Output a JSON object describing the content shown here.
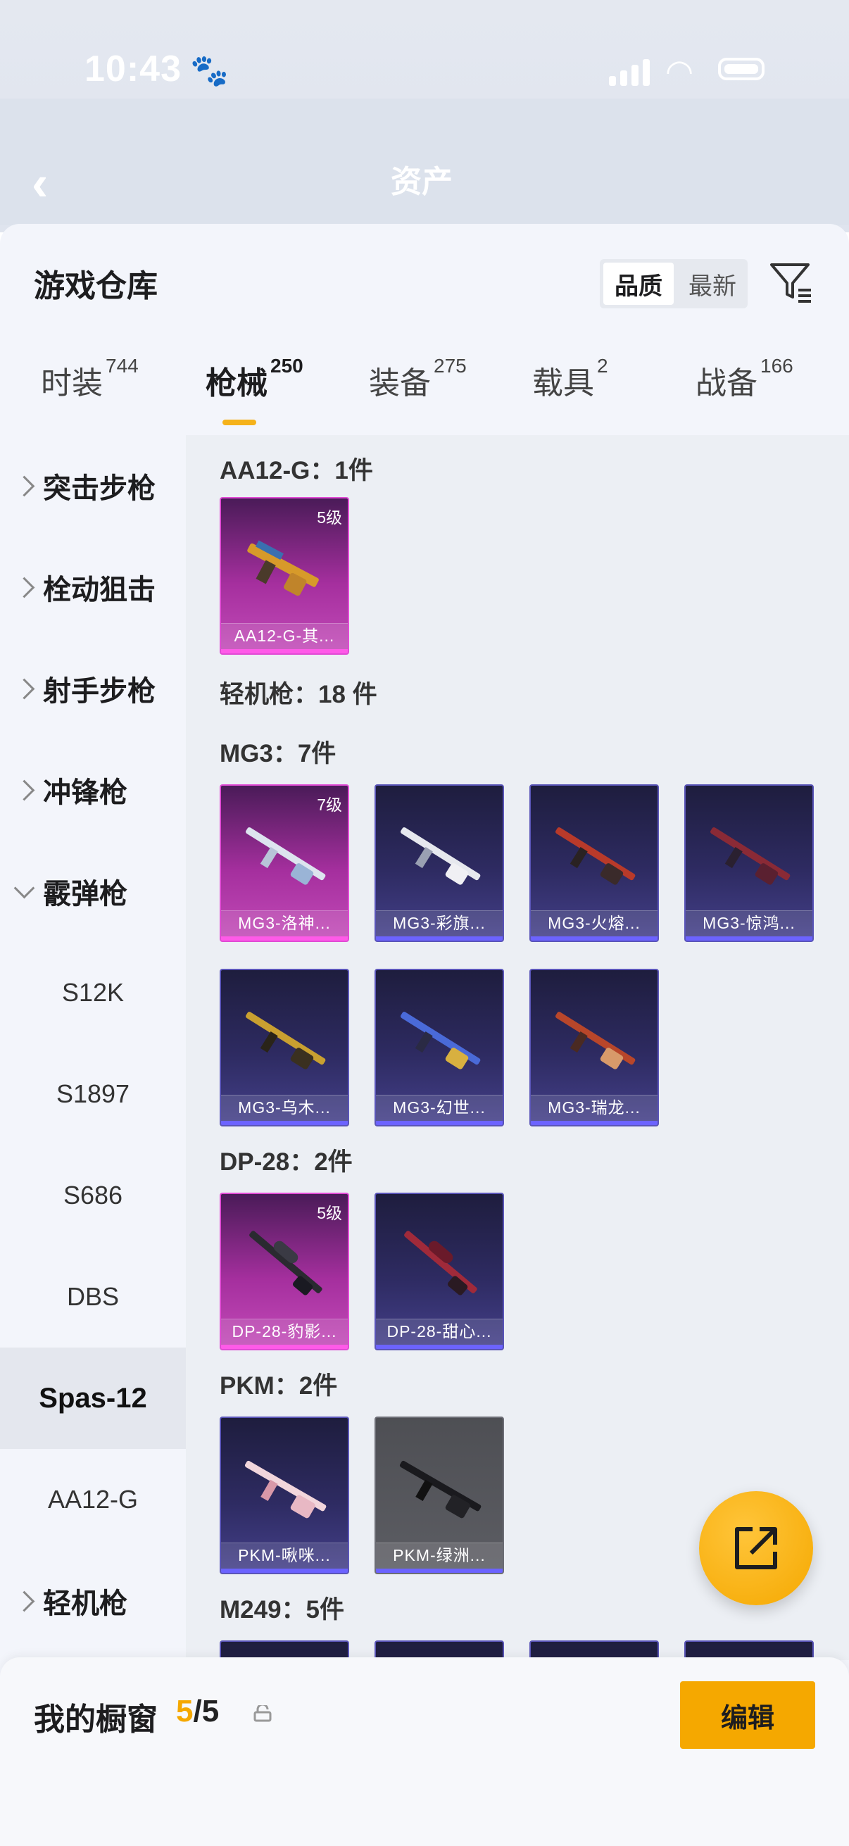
{
  "status_bar": {
    "time": "10:43"
  },
  "header": {
    "title": "资产"
  },
  "warehouse": {
    "title": "游戏仓库",
    "sort_options": [
      "品质",
      "最新"
    ],
    "tabs": [
      {
        "label": "时装",
        "count": "744"
      },
      {
        "label": "枪械",
        "count": "250"
      },
      {
        "label": "装备",
        "count": "275"
      },
      {
        "label": "载具",
        "count": "2"
      },
      {
        "label": "战备",
        "count": "166"
      }
    ]
  },
  "sidebar": {
    "categories": [
      "突击步枪",
      "栓动狙击",
      "射手步枪",
      "冲锋枪",
      "霰弹枪"
    ],
    "shotgun_items": [
      "S12K",
      "S1897",
      "S686",
      "DBS",
      "Spas-12",
      "AA12-G"
    ],
    "last_category": "轻机枪"
  },
  "groups": {
    "aa12": {
      "title": "AA12-G：1件",
      "cards": [
        {
          "name": "AA12-G-其...",
          "level": "5级",
          "rarity": "pink"
        }
      ]
    },
    "lmg": {
      "title": "轻机枪：18 件"
    },
    "mg3": {
      "title": "MG3：7件",
      "cards": [
        {
          "name": "MG3-洛神...",
          "level": "7级",
          "rarity": "pink"
        },
        {
          "name": "MG3-彩旗...",
          "rarity": "blue"
        },
        {
          "name": "MG3-火熔...",
          "rarity": "blue"
        },
        {
          "name": "MG3-惊鸿...",
          "rarity": "blue"
        },
        {
          "name": "MG3-乌木...",
          "rarity": "blue"
        },
        {
          "name": "MG3-幻世...",
          "rarity": "blue"
        },
        {
          "name": "MG3-瑞龙...",
          "rarity": "blue"
        }
      ]
    },
    "dp28": {
      "title": "DP-28：2件",
      "cards": [
        {
          "name": "DP-28-豹影...",
          "level": "5级",
          "rarity": "pink"
        },
        {
          "name": "DP-28-甜心...",
          "rarity": "blue"
        }
      ]
    },
    "pkm": {
      "title": "PKM：2件",
      "cards": [
        {
          "name": "PKM-啾咪...",
          "rarity": "blue"
        },
        {
          "name": "PKM-绿洲...",
          "rarity": "gray"
        }
      ]
    },
    "m249": {
      "title": "M249：5件"
    }
  },
  "showcase": {
    "label": "我的橱窗",
    "current": "5",
    "separator": "/",
    "total": "5",
    "edit_label": "编辑"
  },
  "colors": {
    "accent": "#f5a800",
    "pink_rarity": "#e04bd4",
    "blue_rarity": "#6c63ff"
  }
}
